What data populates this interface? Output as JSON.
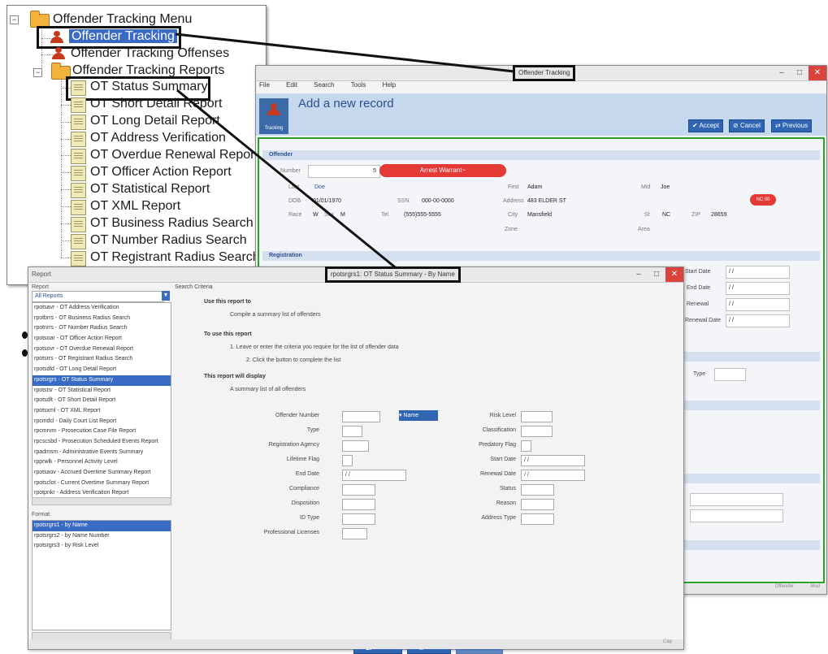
{
  "tree": {
    "root": "Offender Tracking Menu",
    "items": [
      "Offender Tracking",
      "Offender Tracking Offenses",
      "Offender Tracking Reports",
      "OT Status Summary",
      "OT Short Detail Report",
      "OT Long Detail Report",
      "OT Address Verification",
      "OT Overdue Renewal Report",
      "OT Officer Action Report",
      "OT Statistical Report",
      "OT XML Report",
      "OT Business Radius Search",
      "OT Number Radius Search",
      "OT Registrant Radius Search"
    ]
  },
  "ot_window": {
    "callout": "Offender Tracking",
    "menu": [
      "File",
      "Edit",
      "Search",
      "Tools",
      "Help"
    ],
    "icon_label": "Tracking",
    "header_title": "Add a new record",
    "buttons": [
      "Accept",
      "Cancel",
      "Previous"
    ],
    "section_offender": "Offender",
    "section_registration": "Registration",
    "arrest_warrant": "Arrest Warrant~",
    "number_label": "Number",
    "number_value": "5",
    "last_label": "Last",
    "last_value": "Doe",
    "first_label": "First",
    "first_value": "Adam",
    "mid_label": "Mid",
    "mid_value": "Joe",
    "dob_label": "DOB",
    "dob_value": "01/01/1970",
    "ssn_label": "SSN",
    "ssn_value": "000-00-0000",
    "address_label": "Address",
    "address_value": "483 ELDER ST",
    "race_label": "Race",
    "race_value": "W",
    "sex_label": "Sex",
    "sex_value": "M",
    "tel_label": "Tel",
    "tel_value": "(555)555-5555",
    "city_label": "City",
    "city_value": "Mansfield",
    "st_label": "St",
    "st_value": "NC",
    "zip_label": "ZIP",
    "zip_value": "28659",
    "zone_label": "Zone",
    "area_label": "Area",
    "badge": "NC 00",
    "right_labels": [
      "Start Date",
      "End Date",
      "Renewal",
      "Renewal Date"
    ],
    "date_value": "/ /",
    "type_label": "Type",
    "status_left": "Offender",
    "status_right": "Mod"
  },
  "report_window": {
    "callout": "rpotsrgrs1: OT Status Summary - By Name",
    "title": "Report",
    "report_label": "Report",
    "combo_value": "All Reports",
    "search_criteria": "Search Criteria",
    "reports": [
      "rpotsavr - OT Address Verification",
      "rpotbrrs - OT Business Radius Search",
      "rpotnrrs - OT Number Radius Search",
      "rpotsoar - OT Officer Action Report",
      "rpotsovr - OT Overdue Renewal Report",
      "rpotsrrs - OT Registrant Radius Search",
      "rpotsdld - OT Long Detail Report",
      "rpotsrgrs - OT Status Summary",
      "rpotstsr - OT Statistical Report",
      "rpotsdlt - OT Short Detail Report",
      "rpotsxml - OT XML Report",
      "rpcmdcl - Daily Court List Report",
      "rpcmrvrn - Prosecution Case File Report",
      "rpcscsbd - Prosecution Scheduled Events Report",
      "rpadmsm - Administrative Events Summary",
      "rpprwlk - Personnel Activity Level",
      "rpotsaov - Accrued Overtime Summary Report",
      "rpotsclot - Current Overtime Summary Report",
      "rpotpnkr - Address Verification Report"
    ],
    "format_label": "Format",
    "formats": [
      "rpotsrgrs1 - by Name",
      "rpotsrgrs2 - by Name Number",
      "rpotsrgrs3 - by Risk Level"
    ],
    "use_heading": "Use this report to",
    "use_text": "Compile a summary list of offenders",
    "howto_heading": "To use this report",
    "howto_text1": "1. Leave or enter the criteria you require for the list of offender data",
    "howto_text2": "2. Click the button to complete the list",
    "display_heading": "This report will display",
    "display_text": "A summary list of all offenders",
    "criteria_left": [
      "Offender Number",
      "Type",
      "Registration Agency",
      "Lifetime Flag",
      "End Date",
      "Compliance",
      "Disposition",
      "ID Type",
      "Professional Licenses"
    ],
    "criteria_right": [
      "Risk Level",
      "Classification",
      "Predatory Flag",
      "Start Date",
      "Renewal Date",
      "Status",
      "Reason",
      "Address Type"
    ],
    "name_button": "Name",
    "date_value": "/ /",
    "bottom_buttons": [
      "Close",
      "Print",
      "Submit"
    ],
    "status_right": "Cap"
  }
}
